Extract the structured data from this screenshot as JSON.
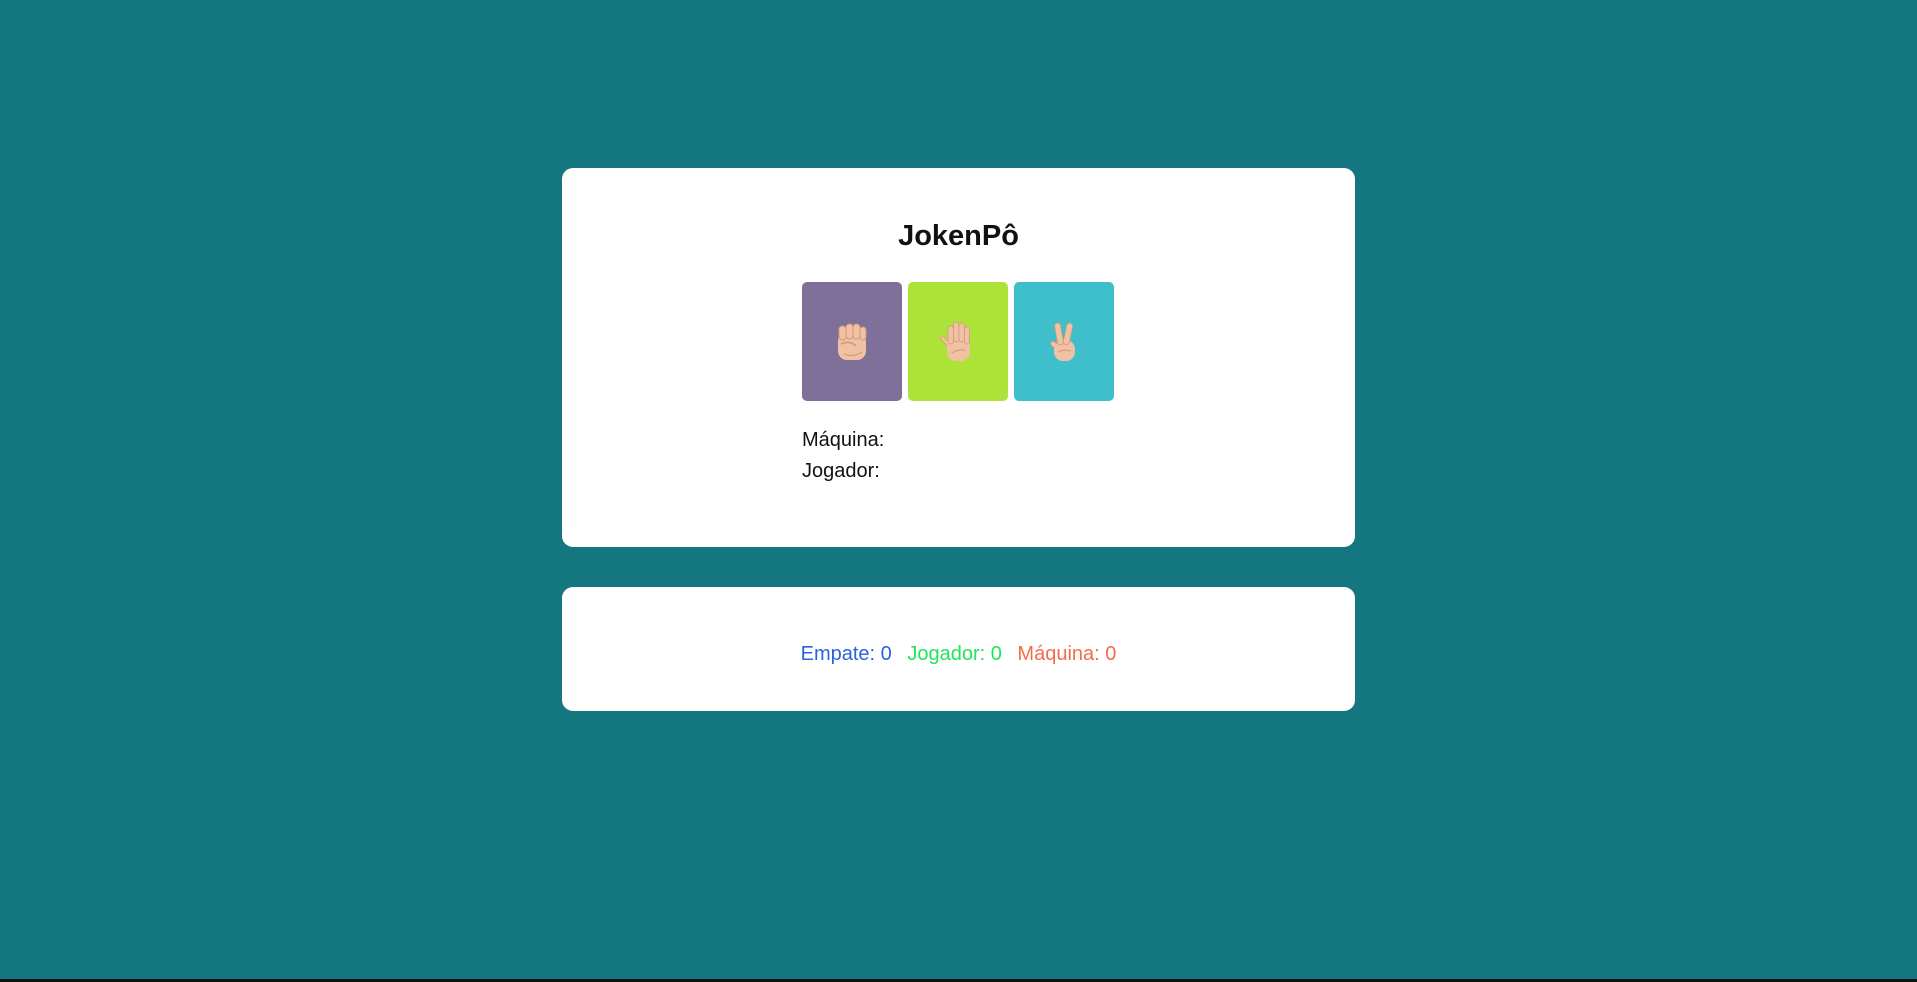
{
  "page": {
    "background": "#14767e"
  },
  "game": {
    "title": "JokenPô",
    "choices": [
      {
        "name": "pedra",
        "icon": "raised-fist-icon",
        "color": "#7f7099"
      },
      {
        "name": "papel",
        "icon": "raised-hand-icon",
        "color": "#ade339"
      },
      {
        "name": "tesoura",
        "icon": "victory-hand-icon",
        "color": "#3fbfcc"
      }
    ],
    "machine_label": "Máquina:",
    "machine_value": "",
    "player_label": "Jogador:",
    "player_value": ""
  },
  "score": {
    "draw_label": "Empate: 0",
    "draw_color": "#2b63de",
    "player_label": "Jogador: 0",
    "player_color": "#22e35a",
    "machine_label": "Máquina: 0",
    "machine_color": "#f26d4a"
  }
}
